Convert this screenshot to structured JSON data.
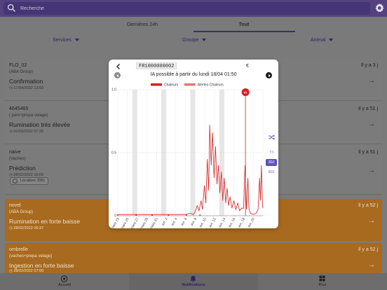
{
  "search": {
    "placeholder": "Recherche"
  },
  "tabs": [
    {
      "label": "Dernières 24h"
    },
    {
      "label": "Tout"
    }
  ],
  "filters": [
    {
      "label": "Services"
    },
    {
      "label": "Groupe"
    },
    {
      "label": "Animal"
    }
  ],
  "cards": [
    {
      "name": "FLO_02",
      "group": "(ABA Group)",
      "title": "Confirmation",
      "date": "17/04/2022 13:50",
      "ago": "Il y a 3 j",
      "color": "#7b7b7b"
    },
    {
      "name": "4645465",
      "group": "( pars+prepa velage)",
      "title": "Rumination très élevée",
      "date": "01/03/2022 07:25",
      "ago": "Il y a 51 j",
      "color": "#7b7b7b"
    },
    {
      "name": "naive",
      "group": "(Vaches)",
      "title": "Prédiction",
      "date": "28/02/2022 16:00",
      "ago": "Il y a 51 j",
      "location": "Location: 336)",
      "color": "#7b7b7b"
    },
    {
      "name": "novel",
      "group": "(ABA Group)",
      "title": "Rumination en forte baisse",
      "date": "28/02/2022 05:37",
      "ago": "Il y a 52 j",
      "color": "#a86a1f"
    },
    {
      "name": "ombrelle",
      "group": "(vaches+prepa velage)",
      "title": "Ingestion en forte baisse",
      "date": "28/02/2022 07:09",
      "ago": "Il y a 52 j",
      "color": "#a86a1f"
    }
  ],
  "bottom_nav": [
    {
      "label": "Accueil",
      "icon": "home-icon"
    },
    {
      "label": "Notifications",
      "icon": "bell-icon"
    },
    {
      "label": "Plus",
      "icon": "grid-icon"
    }
  ],
  "modal": {
    "animal_id": "FR1000000002",
    "heading": "IA possible à partir du lundi 18/04 01:50",
    "ranges": {
      "r7": "7J",
      "r30": "30J",
      "r60": "60J"
    },
    "cow_icon": "€"
  },
  "chart_data": {
    "type": "line",
    "title": "",
    "ylim": [
      0,
      1.0
    ],
    "yticks": [
      "1.0",
      "0.5",
      "0"
    ],
    "legend": [
      {
        "name": "Chaleurs",
        "color": "#d62020"
      },
      {
        "name": "Alertes Chaleurs",
        "color": "#e07a7a"
      }
    ],
    "x_labels": [
      "mars 23",
      "mars 25",
      "mars 27",
      "mars 29",
      "mars 31",
      "avr. 2",
      "avr. 4",
      "avr. 6",
      "avr. 8",
      "avr. 10",
      "avr. 12",
      "avr. 14",
      "avr. 16",
      "avr. 18",
      "avr. 20"
    ],
    "x_range": [
      0,
      30
    ],
    "shaded_bands": [
      [
        3,
        4
      ],
      [
        9,
        10
      ],
      [
        15,
        16
      ],
      [
        21,
        22
      ]
    ],
    "series_color": "#d62020",
    "series": [
      {
        "name": "Chaleurs",
        "points": [
          [
            0,
            0.01
          ],
          [
            3,
            0.01
          ],
          [
            6,
            0.01
          ],
          [
            8,
            0.01
          ],
          [
            10,
            0.01
          ],
          [
            12,
            0.01
          ],
          [
            14,
            0.01
          ],
          [
            15,
            0.02
          ],
          [
            15.6,
            0.01
          ],
          [
            16.0,
            0.03
          ],
          [
            16.4,
            0.08
          ],
          [
            16.8,
            0.04
          ],
          [
            17.2,
            0.12
          ],
          [
            17.5,
            0.05
          ],
          [
            17.9,
            0.24
          ],
          [
            18.2,
            0.1
          ],
          [
            18.5,
            0.45
          ],
          [
            18.8,
            0.2
          ],
          [
            19.0,
            0.72
          ],
          [
            19.3,
            0.4
          ],
          [
            19.6,
            0.66
          ],
          [
            19.9,
            0.3
          ],
          [
            20.2,
            0.55
          ],
          [
            20.5,
            0.25
          ],
          [
            20.8,
            0.4
          ],
          [
            21.1,
            0.18
          ],
          [
            21.4,
            0.35
          ],
          [
            21.7,
            0.12
          ],
          [
            22.0,
            0.3
          ],
          [
            22.3,
            0.1
          ],
          [
            22.6,
            0.22
          ],
          [
            22.9,
            0.08
          ],
          [
            23.2,
            0.15
          ],
          [
            23.6,
            0.06
          ],
          [
            24.0,
            0.12
          ],
          [
            24.4,
            0.05
          ],
          [
            24.8,
            0.1
          ],
          [
            25.2,
            0.04
          ],
          [
            25.6,
            0.06
          ],
          [
            26.0,
            0.06
          ],
          [
            26.3,
            0.4
          ],
          [
            26.6,
            0.05
          ],
          [
            26.9,
            0.3
          ],
          [
            27.1,
            0.06
          ],
          [
            27.4,
            0.02
          ],
          [
            28.0,
            0.01
          ],
          [
            28.6,
            0.02
          ],
          [
            29.0,
            0.05
          ],
          [
            29.3,
            0.3
          ],
          [
            29.5,
            0.12
          ],
          [
            29.7,
            0.4
          ],
          [
            29.9,
            0.1
          ],
          [
            30,
            0.06
          ]
        ]
      }
    ],
    "alert_markers": [
      0.0,
      3.8,
      7.1,
      10.5,
      14.2,
      17.0
    ],
    "heat_alert": {
      "x": 26.4,
      "y": 0.98,
      "label": "IA"
    }
  }
}
